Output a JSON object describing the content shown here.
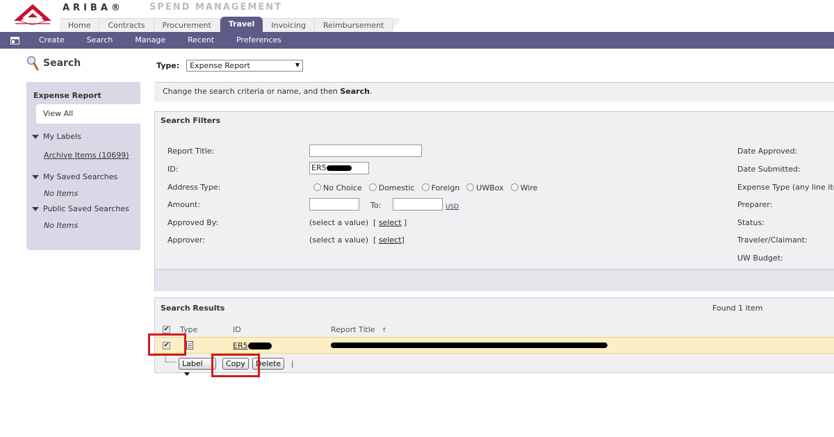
{
  "header": {
    "brand": "ARIBA®",
    "product": "SPEND MANAGEMENT",
    "tabs": [
      {
        "label": "Home"
      },
      {
        "label": "Contracts"
      },
      {
        "label": "Procurement"
      },
      {
        "label": "Travel",
        "active": true
      },
      {
        "label": "Invoicing"
      },
      {
        "label": "Reimbursement"
      }
    ]
  },
  "nav": {
    "items": [
      {
        "label": "Create"
      },
      {
        "label": "Search"
      },
      {
        "label": "Manage"
      },
      {
        "label": "Recent"
      },
      {
        "label": "Preferences"
      }
    ]
  },
  "left": {
    "heading": "Search",
    "section": "Expense Report",
    "view_all": "View All",
    "my_labels": "My Labels",
    "archive_items": "Archive Items (10699)",
    "my_saved": "My Saved Searches",
    "my_saved_empty": "No Items",
    "public_saved": "Public Saved Searches",
    "public_saved_empty": "No Items"
  },
  "type_selector": {
    "label": "Type:",
    "value": "Expense Report"
  },
  "instruction": {
    "text": "Change the search criteria or name, and then ",
    "emphasis": "Search",
    "end": "."
  },
  "filters": {
    "title": "Search Filters",
    "report_title_label": "Report Title:",
    "id_label": "ID:",
    "id_value": "ER5",
    "address_type_label": "Address Type:",
    "address_options": [
      "No Choice",
      "Domestic",
      "Foreign",
      "UWBox",
      "Wire"
    ],
    "amount_label": "Amount:",
    "to_label": "To:",
    "currency": "USD",
    "approved_by_label": "Approved By:",
    "approver_label": "Approver:",
    "select_value_text": "(select a value)",
    "select_link": "select",
    "right_labels": [
      "Date Approved:",
      "Date Submitted:",
      "Expense Type (any line ite",
      "Preparer:",
      "Status:",
      "Traveler/Claimant:",
      "UW Budget:"
    ]
  },
  "results": {
    "title": "Search Results",
    "found": "Found 1 item",
    "columns": {
      "type": "Type",
      "id": "ID",
      "title": "Report Title",
      "sort_indicator": "↑"
    },
    "row": {
      "id": "ER5"
    },
    "buttons": {
      "label": "Label",
      "copy": "Copy",
      "delete": "Delete"
    },
    "separator": "|"
  },
  "colors": {
    "nav_bg": "#5d5b87",
    "panel_bg": "#d9d8e6",
    "selected_row": "#fdefc3",
    "highlight": "#d41a1a"
  }
}
